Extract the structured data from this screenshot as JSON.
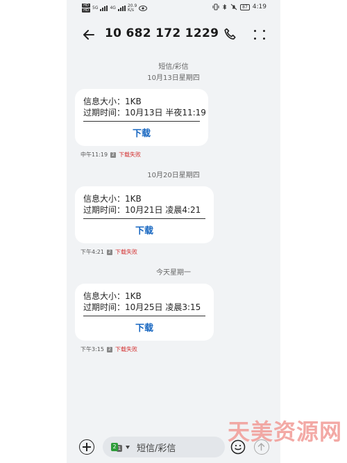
{
  "status_bar": {
    "sim1": "HD",
    "sim2": "HD",
    "net1": "5G",
    "net2": "4G",
    "speed_value": "20.9",
    "speed_unit": "K/s",
    "battery": "87",
    "time": "4:19"
  },
  "header": {
    "title": "10 682 172 1229"
  },
  "thread": {
    "type_label": "短信/彩信",
    "messages": [
      {
        "date": "10月13日星期四",
        "size_line": "信息大小：1KB",
        "expire_line": "过期时间：10月13日 半夜11:19",
        "download": "下载",
        "time": "中午11:19",
        "sim": "2",
        "status": "下载失败"
      },
      {
        "date": "10月20日星期四",
        "size_line": "信息大小：1KB",
        "expire_line": "过期时间：10月21日 凌晨4:21",
        "download": "下载",
        "time": "下午4:21",
        "sim": "2",
        "status": "下载失败"
      },
      {
        "date": "今天星期一",
        "size_line": "信息大小：1KB",
        "expire_line": "过期时间：10月25日 凌晨3:15",
        "download": "下载",
        "time": "下午3:15",
        "sim": "2",
        "status": "下载失败"
      }
    ]
  },
  "composer": {
    "sim_selected": "2",
    "sim_other": "1",
    "placeholder": "短信/彩信"
  },
  "watermark": "天美资源网",
  "colors": {
    "link": "#1565c0",
    "error": "#d32f2f",
    "sim_active": "#2e9d3a",
    "watermark": "#f19b96"
  }
}
